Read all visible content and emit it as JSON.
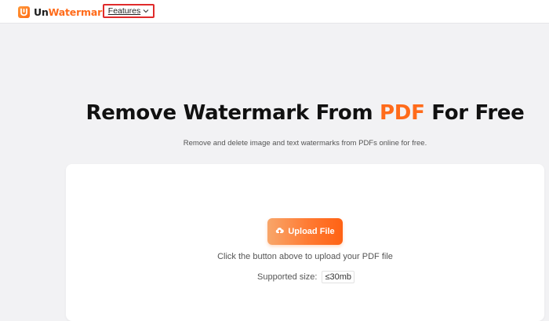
{
  "header": {
    "brand": {
      "prefix": "Un",
      "accent": "Watermark"
    },
    "nav": {
      "features_label": "Features"
    }
  },
  "hero": {
    "title_before": "Remove Watermark From ",
    "title_accent": "PDF",
    "title_after": " For Free",
    "subtitle": "Remove and delete image and text watermarks from PDFs online for free."
  },
  "upload": {
    "button_label": "Upload File",
    "hint": "Click the button above to upload your PDF file",
    "size_label": "Supported size:",
    "size_value": "≤30mb"
  },
  "icons": {
    "logo": "unwatermark-logo-icon",
    "features_caret": "chevron-down-icon",
    "upload": "cloud-upload-icon"
  },
  "colors": {
    "accent": "#ff6b1a",
    "highlight_box": "#e02b2b",
    "page_bg": "#f2f2f4"
  }
}
